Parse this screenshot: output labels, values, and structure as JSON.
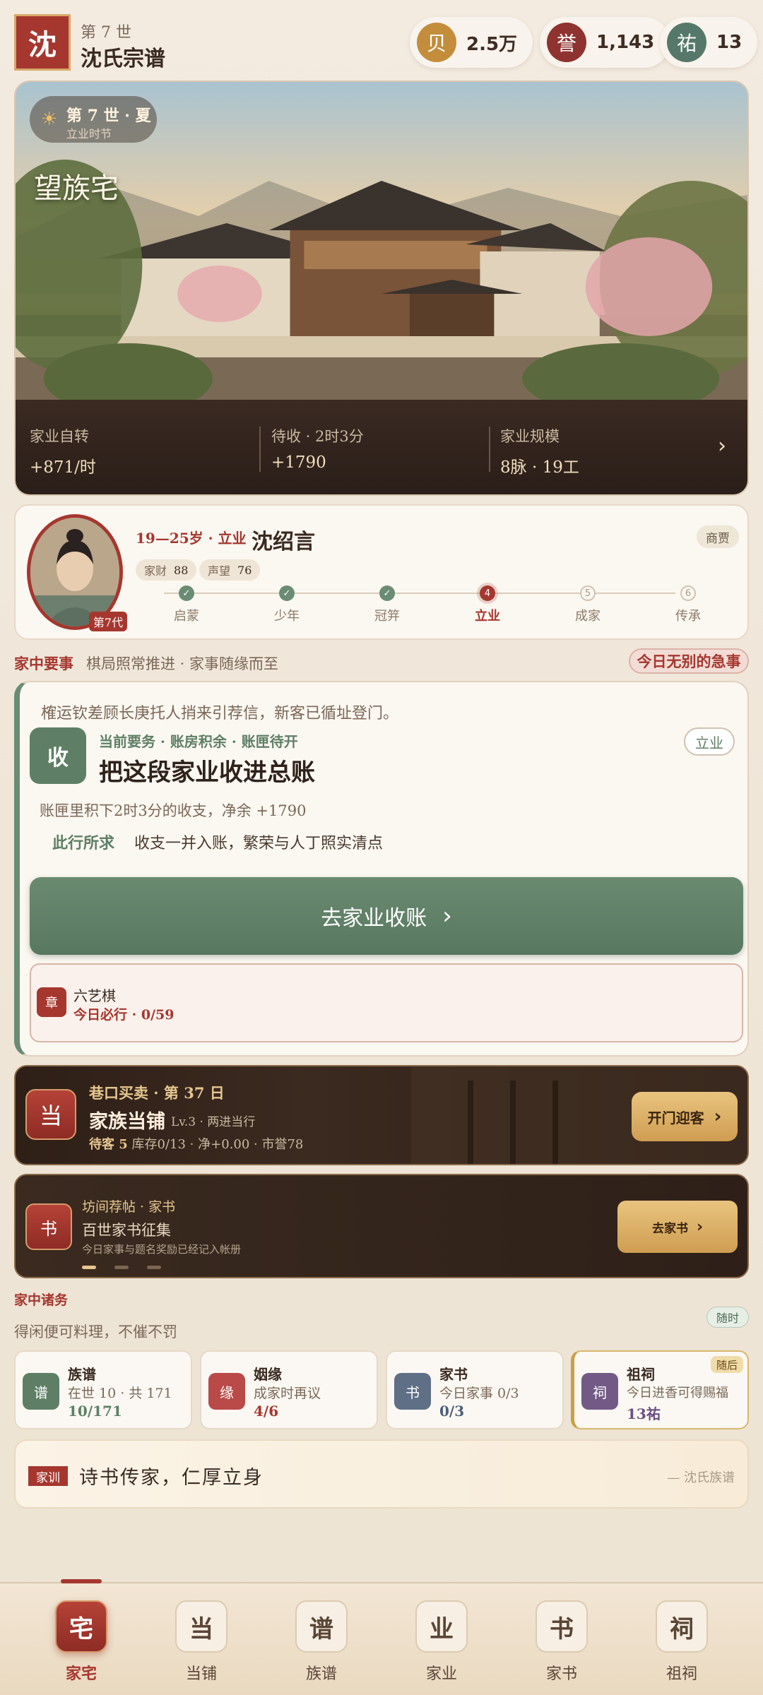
{
  "header": {
    "logo_char": "沈",
    "generation_label": "第 7 世",
    "clan_title": "沈氏宗谱",
    "resources": [
      {
        "icon_char": "贝",
        "value": "2.5万",
        "color": "#c38d3c"
      },
      {
        "icon_char": "誉",
        "value": "1,143",
        "color": "#8f3330"
      },
      {
        "icon_char": "祐",
        "value": "13",
        "color": "#55786a"
      }
    ]
  },
  "hero": {
    "season_main": "第 7 世 · 夏",
    "season_sub": "立业时节",
    "estate_name": "望族宅",
    "stats": [
      {
        "label": "家业自转",
        "value": "+871/时"
      },
      {
        "label": "待收 · 2时3分",
        "value": "+1790"
      },
      {
        "label": "家业规模",
        "value": "8脉 · 19工"
      }
    ]
  },
  "character": {
    "age_stage": "19—25岁 · 立业",
    "name": "沈绍言",
    "generation_badge": "第7代",
    "occupation": "商贾",
    "attrs": [
      {
        "label": "家财",
        "value": "88"
      },
      {
        "label": "声望",
        "value": "76"
      }
    ],
    "timeline": [
      {
        "label": "启蒙",
        "state": "done",
        "mark": "✓"
      },
      {
        "label": "少年",
        "state": "done",
        "mark": "✓"
      },
      {
        "label": "冠笄",
        "state": "done",
        "mark": "✓"
      },
      {
        "label": "立业",
        "state": "current",
        "mark": "4"
      },
      {
        "label": "成家",
        "state": "future",
        "mark": "5"
      },
      {
        "label": "传承",
        "state": "future",
        "mark": "6"
      }
    ]
  },
  "affairs": {
    "title": "家中要事",
    "subtitle": "棋局照常推进 · 家事随缘而至",
    "urgent_label": "今日无别的急事",
    "task": {
      "note": "榷运钦差顾长庚托人捎来引荐信，新客已循址登门。",
      "icon_char": "收",
      "tags": "当前要务 · 账房积余 · 账匣待开",
      "title": "把这段家业收进总账",
      "stage": "立业",
      "desc": "账匣里积下2时3分的收支，净余 +1790",
      "aim_label": "此行所求",
      "aim": "收支一并入账，繁荣与人丁照实清点",
      "button_label": "去家业收账",
      "sub_icon": "章",
      "sub_title": "六艺棋",
      "sub_progress": "今日必行 · 0/59"
    }
  },
  "shop": {
    "icon_char": "当",
    "top_line": "巷口买卖 · 第 37 日",
    "name": "家族当铺",
    "level": "Lv.3 · 两进当行",
    "stats_lead": "待客 5",
    "stats_rest": "库存0/13 · 净+0.00 · 市誉78",
    "button_label": "开门迎客"
  },
  "letters": {
    "icon_char": "书",
    "top_line": "坊间荐帖 · 家书",
    "name": "百世家书征集",
    "sub": "今日家事与题名奖励已经记入帐册",
    "button_label": "去家书"
  },
  "chores": {
    "title": "家中诸务",
    "subtitle": "得闲便可料理，不催不罚",
    "anytime_label": "随时",
    "items": [
      {
        "icon": "谱",
        "name": "族谱",
        "desc": "在世 10 · 共 171",
        "progress": "10/171",
        "color": "#5e7f66",
        "prog_color": "#5e7f66"
      },
      {
        "icon": "缘",
        "name": "姻缘",
        "desc": "成家时再议",
        "progress": "4/6",
        "color": "#b94a48",
        "prog_color": "#a5372f"
      },
      {
        "icon": "书",
        "name": "家书",
        "desc": "今日家事 0/3",
        "progress": "0/3",
        "color": "#5f6f86",
        "prog_color": "#4d5f7a"
      },
      {
        "icon": "祠",
        "name": "祖祠",
        "desc": "今日进香可得赐福",
        "progress": "13祐",
        "color": "#735a86",
        "prog_color": "#6a4f82",
        "badge": "随后"
      }
    ]
  },
  "motto": {
    "tag": "家训",
    "text": "诗书传家，仁厚立身",
    "source": "— 沈氏族谱"
  },
  "nav": [
    {
      "char": "宅",
      "label": "家宅",
      "active": true
    },
    {
      "char": "当",
      "label": "当铺"
    },
    {
      "char": "谱",
      "label": "族谱"
    },
    {
      "char": "业",
      "label": "家业"
    },
    {
      "char": "书",
      "label": "家书"
    },
    {
      "char": "祠",
      "label": "祖祠"
    }
  ]
}
